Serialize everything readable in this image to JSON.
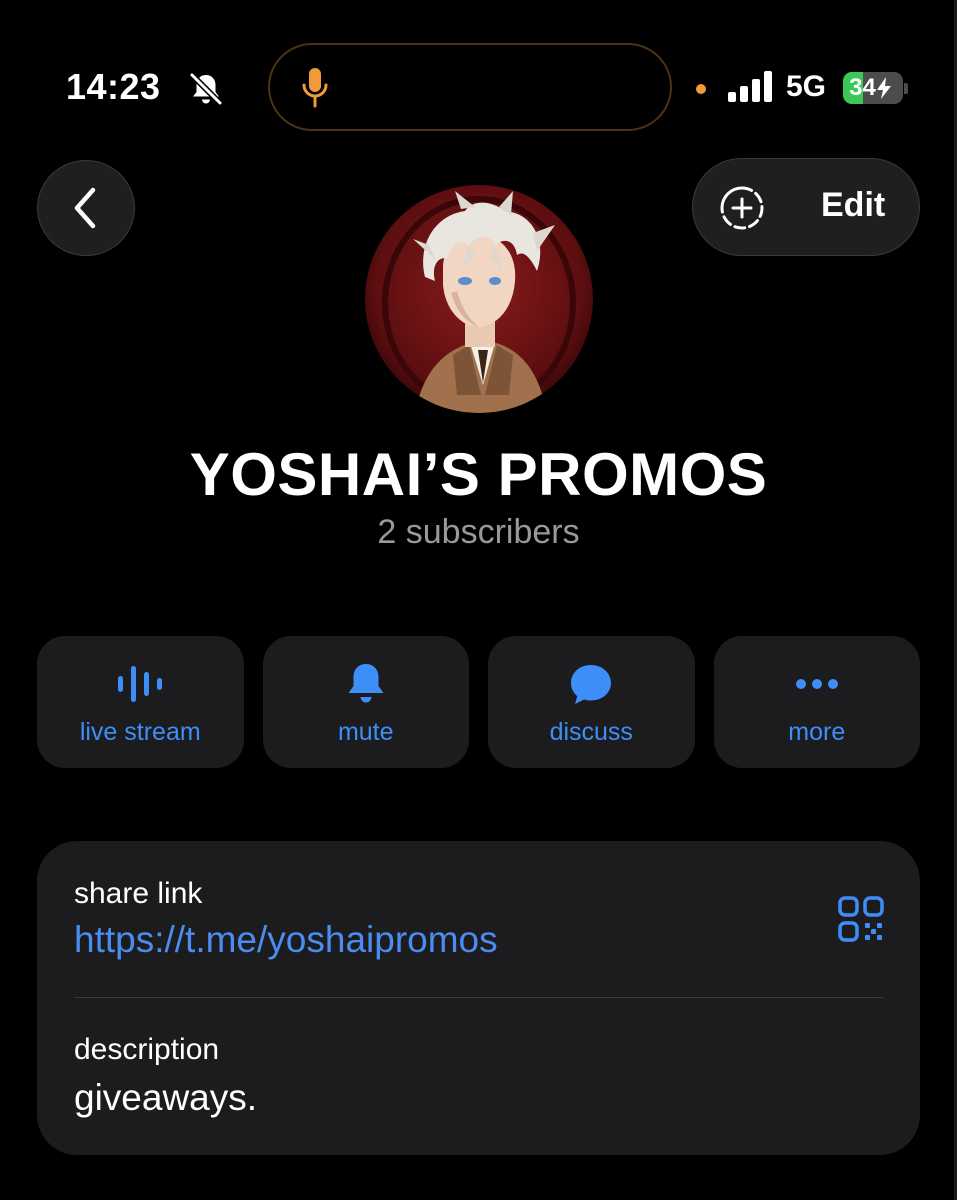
{
  "status_bar": {
    "time": "14:23",
    "network": "5G",
    "battery": "34",
    "battery_level": 0.34,
    "icons": [
      "bell-slash-icon",
      "microphone-icon",
      "signal-bars-icon",
      "battery-charging-icon"
    ]
  },
  "header": {
    "back_icon": "chevron-left-icon",
    "edit_label": "Edit",
    "add_story_icon": "add-story-icon"
  },
  "channel": {
    "title": "YOSHAI’S PROMOS",
    "subscribers": "2 subscribers"
  },
  "actions": [
    {
      "label": "live stream",
      "icon": "live-stream-icon"
    },
    {
      "label": "mute",
      "icon": "bell-icon"
    },
    {
      "label": "discuss",
      "icon": "chat-bubble-icon"
    },
    {
      "label": "more",
      "icon": "more-dots-icon"
    }
  ],
  "info": {
    "share_link_label": "share link",
    "share_link": "https://t.me/yoshaipromos",
    "qr_icon": "qr-code-icon",
    "description_label": "description",
    "description": "giveaways."
  },
  "colors": {
    "accent": "#3e8ef7",
    "background": "#000000",
    "card": "#1c1c1e",
    "battery_green": "#3bc858",
    "mic_orange": "#f19a37"
  }
}
